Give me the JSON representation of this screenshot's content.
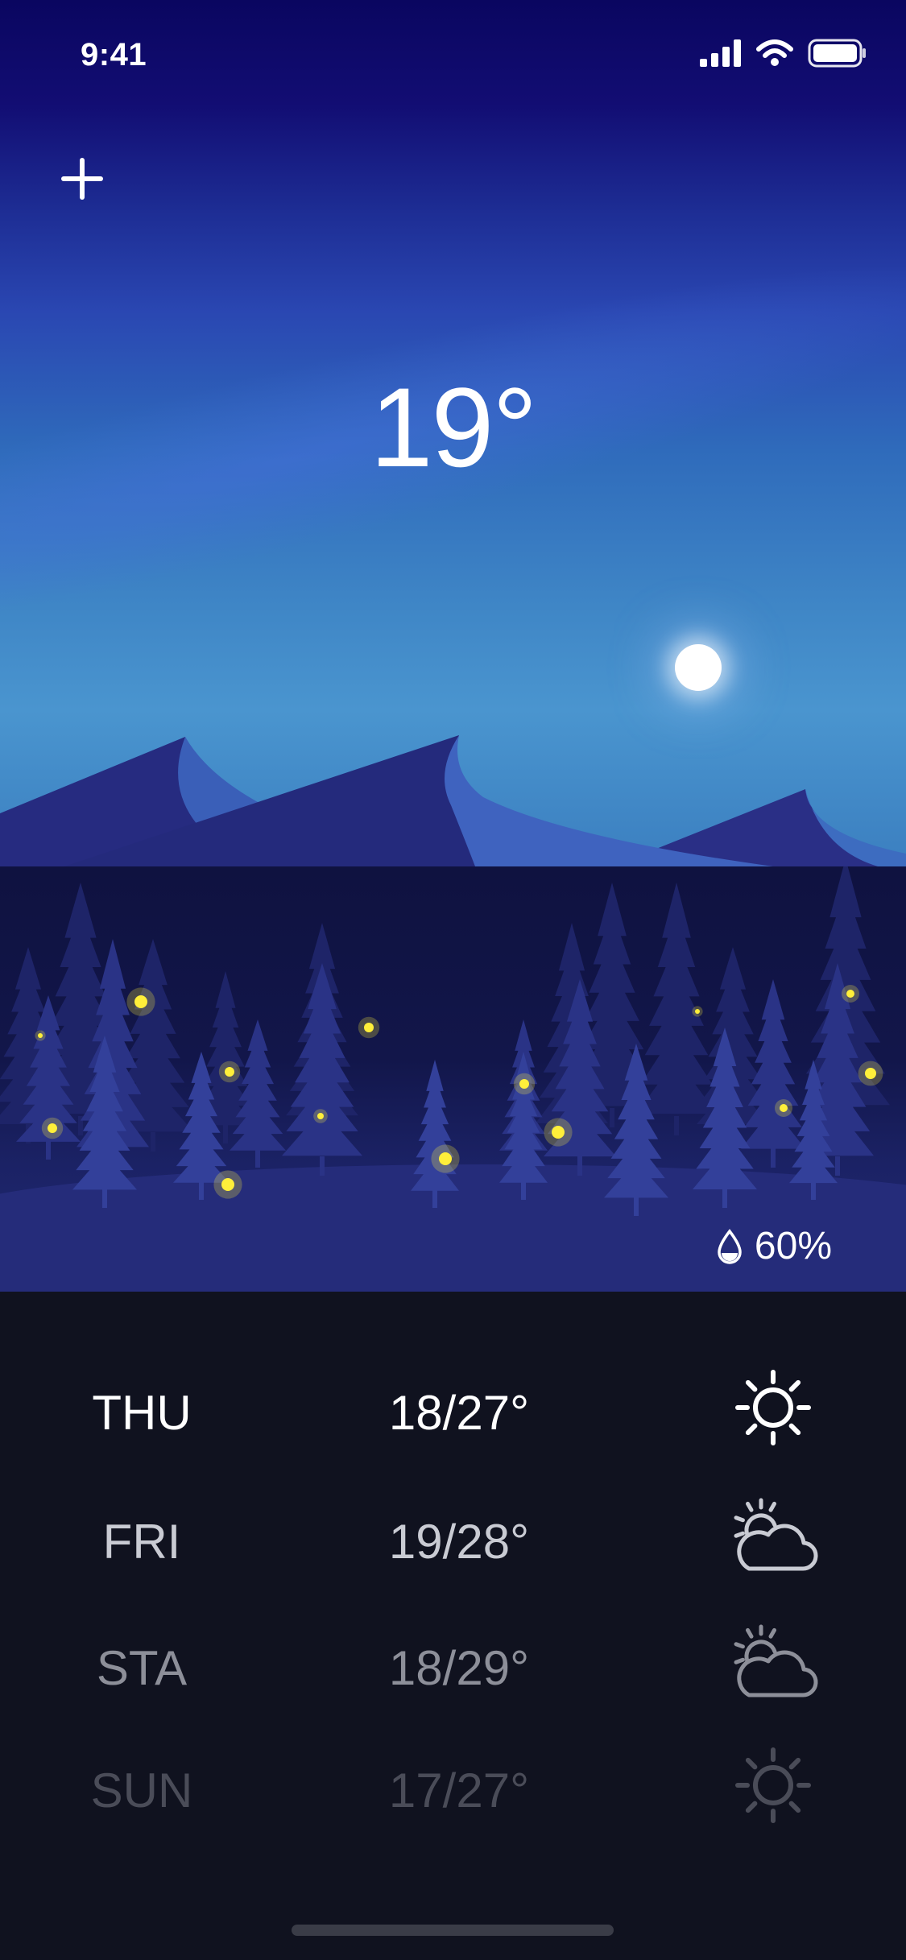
{
  "status_bar": {
    "time": "9:41",
    "signal_icon": "cellular-signal-icon",
    "wifi_icon": "wifi-icon",
    "battery_icon": "battery-icon"
  },
  "header": {
    "add_icon": "plus-icon"
  },
  "current": {
    "temperature": "19",
    "degree_symbol": "°",
    "humidity": "60%",
    "humidity_icon": "water-drop-icon"
  },
  "forecast": [
    {
      "day": "THU",
      "range": "18/27°",
      "icon": "sun-icon",
      "color": "#ffffff"
    },
    {
      "day": "FRI",
      "range": "19/28°",
      "icon": "partly-cloudy-icon",
      "color": "#c9cbd3"
    },
    {
      "day": "STA",
      "range": "18/29°",
      "icon": "partly-cloudy-icon",
      "color": "#8d8f99"
    },
    {
      "day": "SUN",
      "range": "17/27°",
      "icon": "sun-icon",
      "color": "#4a4c58"
    }
  ],
  "colors": {
    "sky_top": "#0a0660",
    "sky_bottom": "#4a95cf",
    "mountain": "#252a7d",
    "forest": "#12164a",
    "panel": "#10121f",
    "firefly": "#ffef3a"
  }
}
